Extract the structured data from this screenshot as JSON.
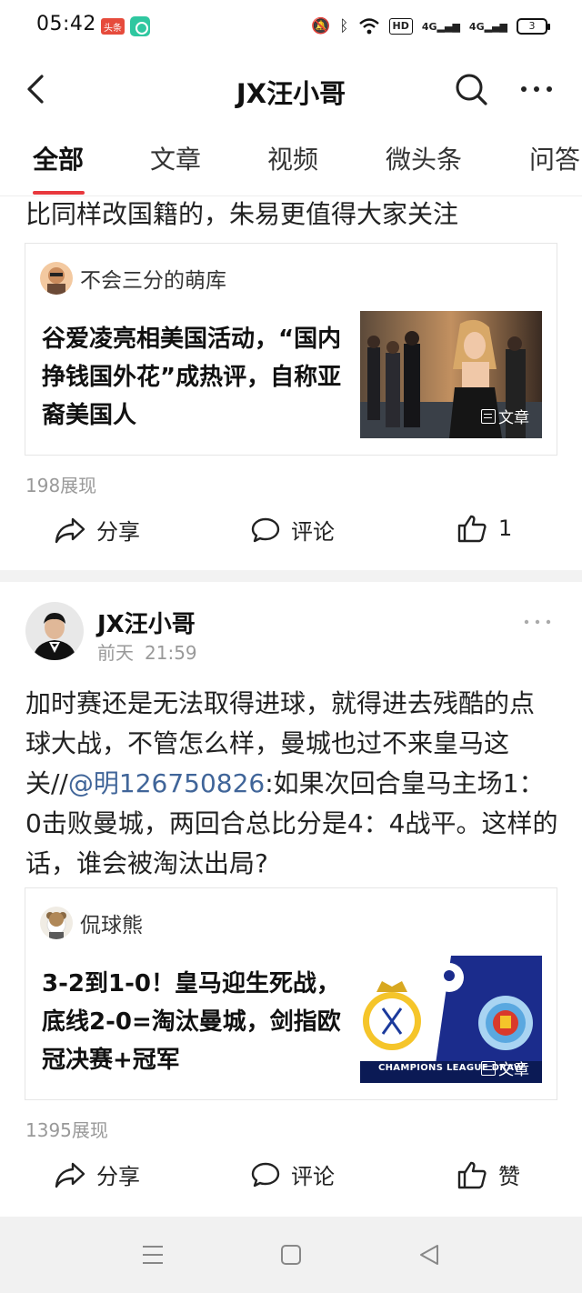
{
  "status_bar": {
    "time": "05:42",
    "badge_text": "头条",
    "network_hd": "HD",
    "signal_1": "4G",
    "signal_2": "4G",
    "battery": "3"
  },
  "header": {
    "title": "JX汪小哥"
  },
  "tabs": [
    {
      "label": "全部",
      "active": true
    },
    {
      "label": "文章"
    },
    {
      "label": "视频"
    },
    {
      "label": "微头条"
    },
    {
      "label": "问答"
    }
  ],
  "post1": {
    "truncated_text": "比同样改国籍的，朱易更值得大家关注",
    "card": {
      "author": "不会三分的萌库",
      "title": "谷爱凌亮相美国活动，“国内挣钱国外花”成热评，自称亚裔美国人",
      "thumb_tag": "文章"
    },
    "impressions": "198展现",
    "actions": {
      "share": "分享",
      "comment": "评论",
      "like": "1"
    }
  },
  "post2": {
    "author": "JX汪小哥",
    "time_day": "前天",
    "time_clock": "21:59",
    "body_before": "加时赛还是无法取得进球，就得进去残酷的点球大战，不管怎么样，曼城也过不来皇马这关//",
    "mention": "@明126750826",
    "body_after": ":如果次回合皇马主场1：0击败曼城，两回合总比分是4：4战平。这样的话，谁会被淘汰出局?",
    "card": {
      "author": "侃球熊",
      "title": "3-2到1-0！皇马迎生死战，底线2-0=淘汰曼城，剑指欧冠决赛+冠军",
      "thumb_caption": "CHAMPIONS LEAGUE DRAW",
      "thumb_tag": "文章"
    },
    "impressions": "1395展现",
    "actions": {
      "share": "分享",
      "comment": "评论",
      "like": "赞"
    }
  },
  "colors": {
    "accent": "#e8383d",
    "mention": "#406599",
    "muted": "#999999"
  }
}
